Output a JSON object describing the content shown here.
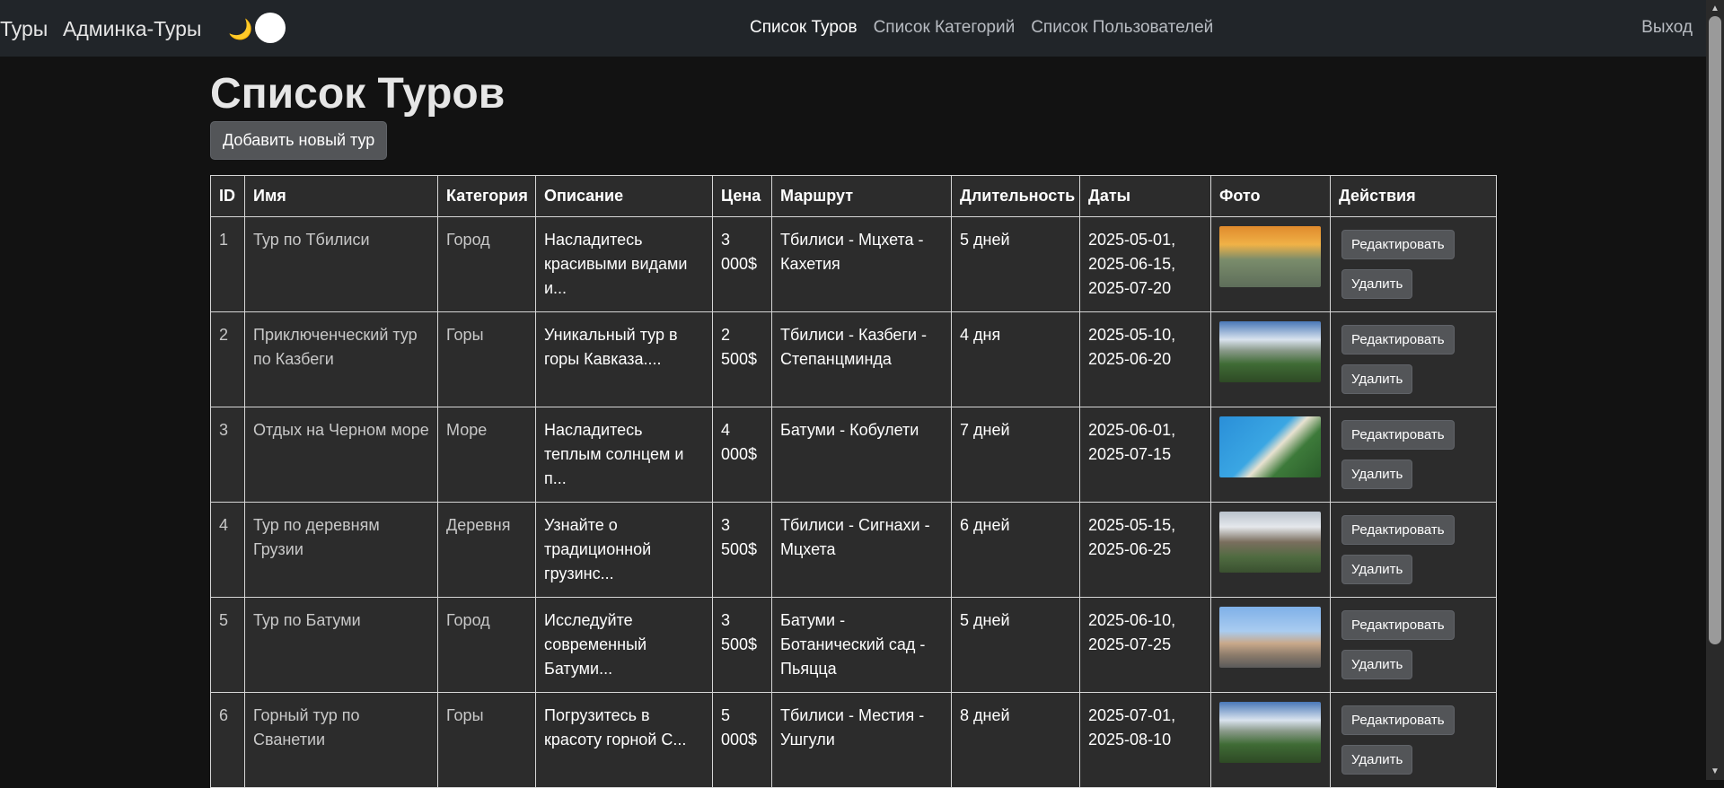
{
  "nav": {
    "brand": "Туры",
    "admin": "Админка-Туры",
    "theme_icon": "moon-icon",
    "links": [
      "Список Туров",
      "Список Категорий",
      "Список Пользователей"
    ],
    "logout": "Выход"
  },
  "page": {
    "title": "Список Туров",
    "add_button": "Добавить новый тур"
  },
  "table": {
    "headers": [
      "ID",
      "Имя",
      "Категория",
      "Описание",
      "Цена",
      "Маршрут",
      "Длительность",
      "Даты",
      "Фото",
      "Действия"
    ],
    "edit_label": "Редактировать",
    "delete_label": "Удалить",
    "rows": [
      {
        "id": "1",
        "name": "Тур по Тбилиси",
        "category": "Город",
        "description": "Насладитесь красивыми видами и...",
        "price": "3 000$",
        "route": "Тбилиси - Мцхета - Кахетия",
        "duration": "5 дней",
        "dates": "2025-05-01, 2025-06-15, 2025-07-20",
        "photo": "city-photo"
      },
      {
        "id": "2",
        "name": "Приключенческий тур по Казбеги",
        "category": "Горы",
        "description": "Уникальный тур в горы Кавказа....",
        "price": "2 500$",
        "route": "Тбилиси - Казбеги - Степанцминда",
        "duration": "4 дня",
        "dates": "2025-05-10, 2025-06-20",
        "photo": "mountain-photo"
      },
      {
        "id": "3",
        "name": "Отдых на Черном море",
        "category": "Море",
        "description": "Насладитесь теплым солнцем и п...",
        "price": "4 000$",
        "route": "Батуми - Кобулети",
        "duration": "7 дней",
        "dates": "2025-06-01, 2025-07-15",
        "photo": "sea-photo"
      },
      {
        "id": "4",
        "name": "Тур по деревням Грузии",
        "category": "Деревня",
        "description": "Узнайте о традиционной грузинс...",
        "price": "3 500$",
        "route": "Тбилиси - Сигнахи - Мцхета",
        "duration": "6 дней",
        "dates": "2025-05-15, 2025-06-25",
        "photo": "village-photo"
      },
      {
        "id": "5",
        "name": "Тур по Батуми",
        "category": "Город",
        "description": "Исследуйте современный Батуми...",
        "price": "3 500$",
        "route": "Батуми - Ботанический сад - Пьяцца",
        "duration": "5 дней",
        "dates": "2025-06-10, 2025-07-25",
        "photo": "batumi-photo"
      },
      {
        "id": "6",
        "name": "Горный тур по Сванетии",
        "category": "Горы",
        "description": "Погрузитесь в красоту горной С...",
        "price": "5 000$",
        "route": "Тбилиси - Местия - Ушгули",
        "duration": "8 дней",
        "dates": "2025-07-01, 2025-08-10",
        "photo": "mountain-photo"
      }
    ]
  }
}
